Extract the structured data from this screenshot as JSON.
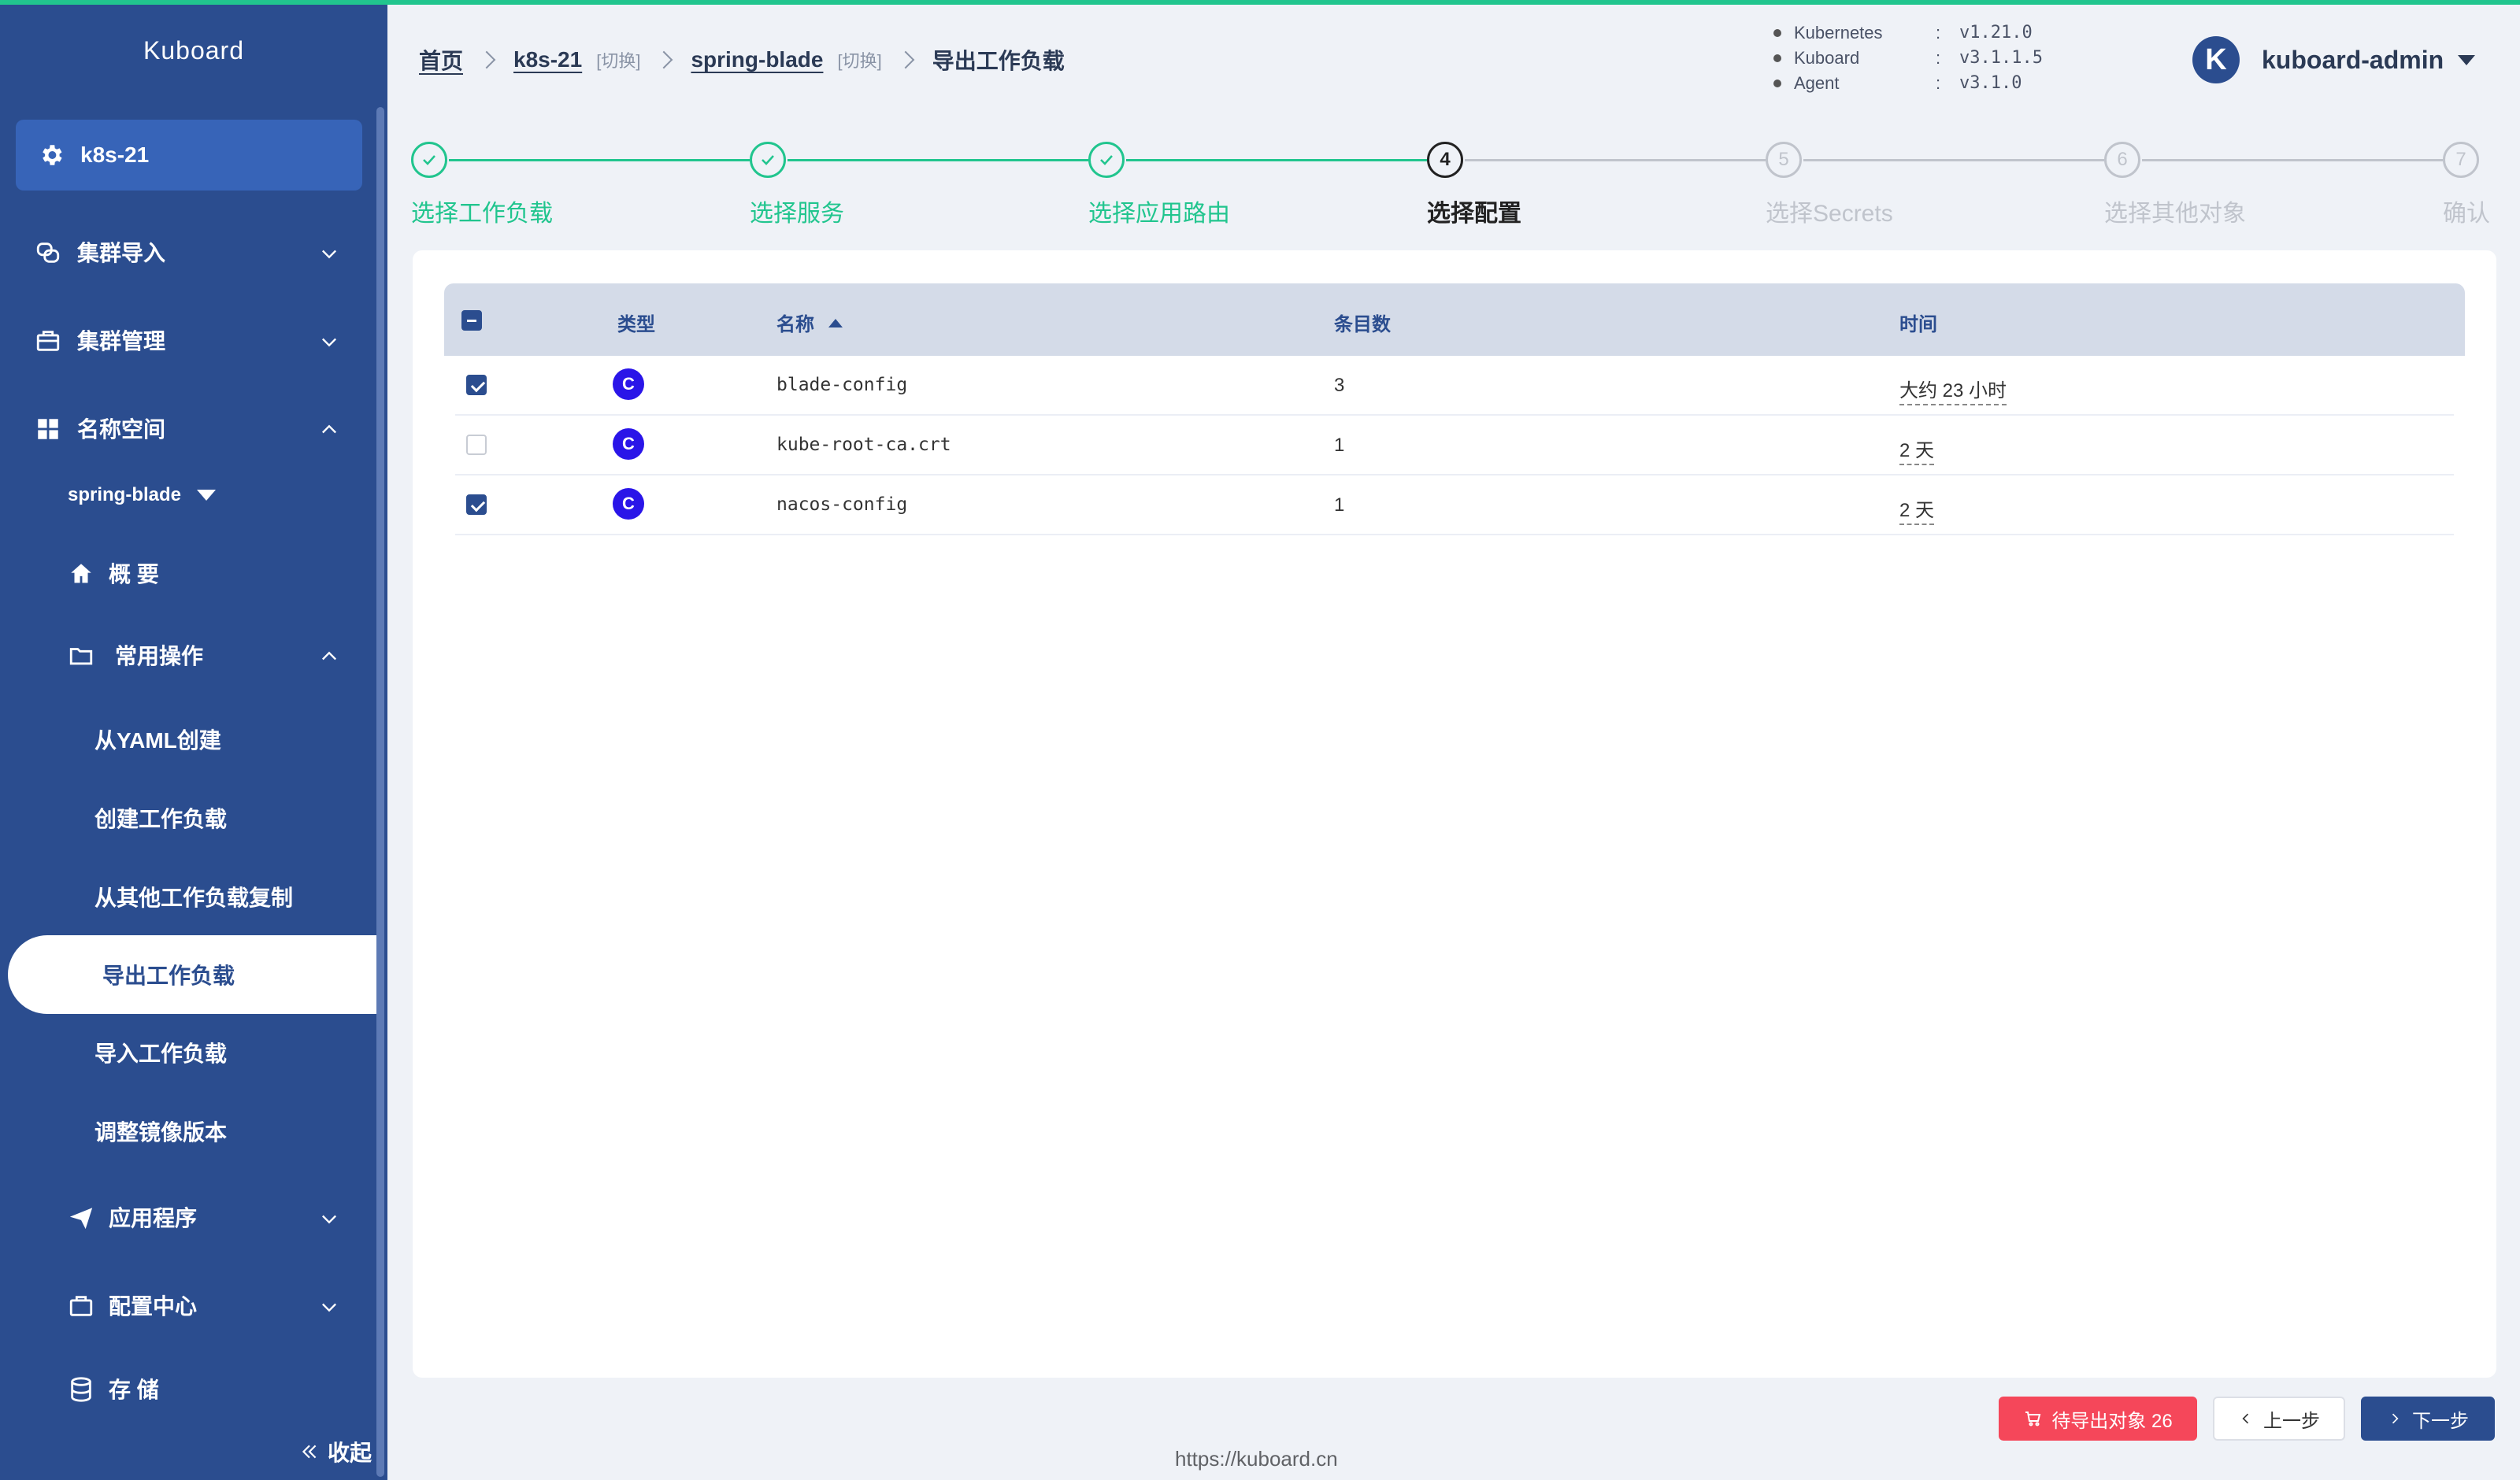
{
  "app": {
    "brand": "Kuboard"
  },
  "sidebar": {
    "cluster": "k8s-21",
    "menu": [
      {
        "label": "集群导入"
      },
      {
        "label": "集群管理"
      },
      {
        "label": "名称空间"
      }
    ],
    "namespace": "spring-blade",
    "overview": "概 要",
    "common_ops": "常用操作",
    "sub_items": [
      "从YAML创建",
      "创建工作负载",
      "从其他工作负载复制",
      "导出工作负载",
      "导入工作负载",
      "调整镜像版本"
    ],
    "bottom_menu": [
      {
        "label": "应用程序"
      },
      {
        "label": "配置中心"
      },
      {
        "label": "存 储"
      }
    ],
    "collapse": "收起"
  },
  "breadcrumb": {
    "home": "首页",
    "cluster": "k8s-21",
    "switch": "[切换]",
    "namespace": "spring-blade",
    "current": "导出工作负载"
  },
  "versions": [
    {
      "name": "Kubernetes",
      "value": "v1.21.0"
    },
    {
      "name": "Kuboard",
      "value": "v3.1.1.5"
    },
    {
      "name": "Agent",
      "value": "v3.1.0"
    }
  ],
  "user": {
    "initial": "K",
    "name": "kuboard-admin"
  },
  "steps": [
    {
      "num": "1",
      "title": "选择工作负载",
      "status": "done"
    },
    {
      "num": "2",
      "title": "选择服务",
      "status": "done"
    },
    {
      "num": "3",
      "title": "选择应用路由",
      "status": "done"
    },
    {
      "num": "4",
      "title": "选择配置",
      "status": "current"
    },
    {
      "num": "5",
      "title": "选择Secrets",
      "status": "pending"
    },
    {
      "num": "6",
      "title": "选择其他对象",
      "status": "pending"
    },
    {
      "num": "7",
      "title": "确认",
      "status": "pending"
    }
  ],
  "table": {
    "headers": {
      "type": "类型",
      "name": "名称",
      "count": "条目数",
      "time": "时间"
    },
    "rows": [
      {
        "checked": true,
        "type_icon": "C",
        "name": "blade-config",
        "count": "3",
        "time": "大约 23 小时"
      },
      {
        "checked": false,
        "type_icon": "C",
        "name": "kube-root-ca.crt",
        "count": "1",
        "time": "2 天"
      },
      {
        "checked": true,
        "type_icon": "C",
        "name": "nacos-config",
        "count": "1",
        "time": "2 天"
      }
    ]
  },
  "buttons": {
    "export": "待导出对象 26",
    "prev": "上一步",
    "next": "下一步"
  },
  "footer": {
    "url": "https://kuboard.cn"
  },
  "colors": {
    "sidebar": "#2b4d8f",
    "accent": "#21c58e",
    "danger": "#f5475a",
    "configmap_icon": "#2a15e8"
  }
}
